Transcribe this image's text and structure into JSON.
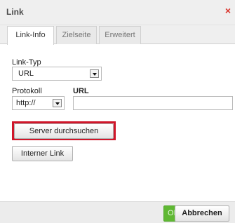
{
  "dialog": {
    "title": "Link",
    "close_symbol": "×",
    "tabs": [
      {
        "label": "Link-Info",
        "active": true
      },
      {
        "label": "Zielseite",
        "active": false
      },
      {
        "label": "Erweitert",
        "active": false
      }
    ]
  },
  "form": {
    "link_type": {
      "label": "Link-Typ",
      "value": "URL"
    },
    "protocol": {
      "label": "Protokoll",
      "value": "http://"
    },
    "url": {
      "label": "URL",
      "value": ""
    },
    "browse_button_label": "Server durchsuchen",
    "internal_link_button_label": "Interner Link"
  },
  "footer": {
    "ok_label": "OK",
    "cancel_label": "Abbrechen"
  },
  "colors": {
    "highlight": "#d0162a",
    "ok_green": "#5fb833",
    "close_red": "#d9342b"
  }
}
